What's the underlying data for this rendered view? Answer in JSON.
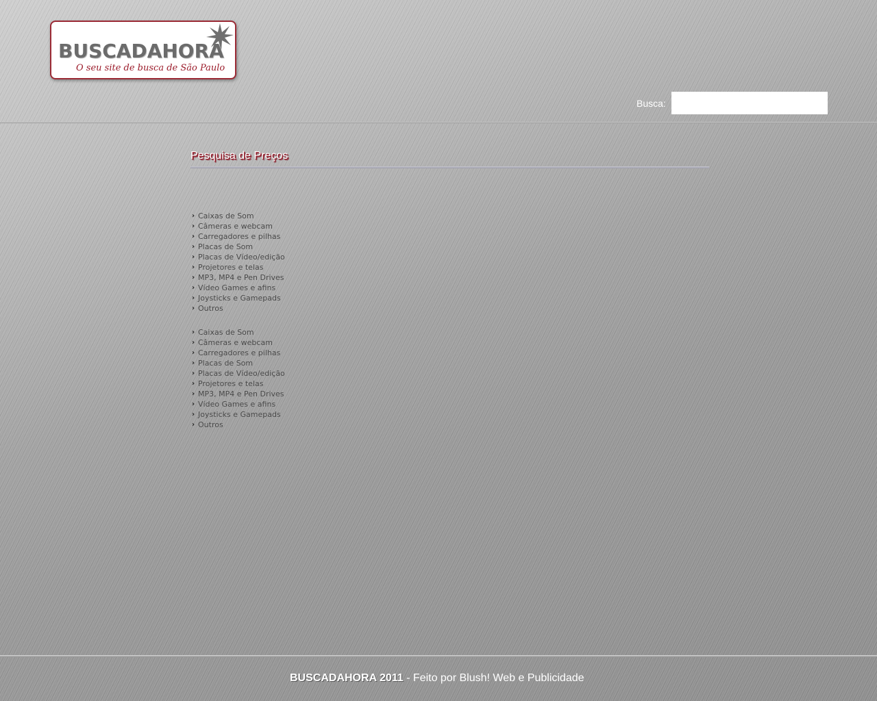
{
  "logo": {
    "name": "BUSCADAHORA",
    "slogan": "O seu site de busca de São Paulo",
    "border_color": "#9b2a35",
    "slogan_color": "#9b1b2a",
    "icon": "starburst-icon"
  },
  "search": {
    "label": "Busca:",
    "value": "",
    "placeholder": ""
  },
  "section": {
    "title": "Pesquisa de Preços",
    "title_shadow_color": "#9b1b2a"
  },
  "categories_top": [
    {
      "label": "Caixas de Som"
    },
    {
      "label": "Câmeras e webcam"
    },
    {
      "label": "Carregadores e pilhas"
    },
    {
      "label": "Placas de Som"
    },
    {
      "label": "Placas de Vídeo/edição"
    },
    {
      "label": "Projetores e telas"
    },
    {
      "label": "MP3, MP4 e Pen Drives"
    },
    {
      "label": "Vídeo Games e afins"
    },
    {
      "label": "Joysticks e Gamepads"
    },
    {
      "label": "Outros"
    }
  ],
  "categories_bottom": [
    {
      "label": "Caixas de Som"
    },
    {
      "label": "Câmeras e webcam"
    },
    {
      "label": "Carregadores e pilhas"
    },
    {
      "label": "Placas de Som"
    },
    {
      "label": "Placas de Vídeo/edição"
    },
    {
      "label": "Projetores e telas"
    },
    {
      "label": "MP3, MP4 e Pen Drives"
    },
    {
      "label": "Vídeo Games e afins"
    },
    {
      "label": "Joysticks e Gamepads"
    },
    {
      "label": "Outros"
    }
  ],
  "category_icon": "chevron-right-icon",
  "footer": {
    "brand": "BUSCADAHORA 2011",
    "text": " - Feito por Blush! Web e Publicidade"
  }
}
